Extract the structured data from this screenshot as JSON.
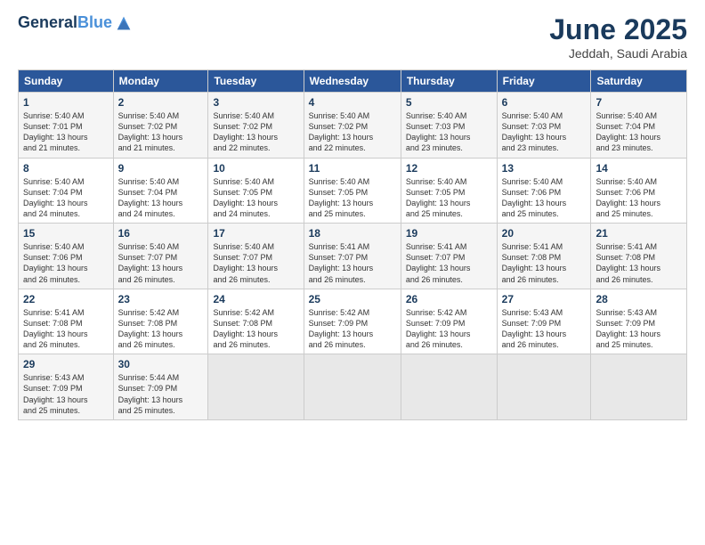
{
  "header": {
    "logo_line1": "General",
    "logo_line2": "Blue",
    "title": "June 2025",
    "subtitle": "Jeddah, Saudi Arabia"
  },
  "days_of_week": [
    "Sunday",
    "Monday",
    "Tuesday",
    "Wednesday",
    "Thursday",
    "Friday",
    "Saturday"
  ],
  "weeks": [
    [
      {
        "day": "1",
        "info": "Sunrise: 5:40 AM\nSunset: 7:01 PM\nDaylight: 13 hours\nand 21 minutes."
      },
      {
        "day": "2",
        "info": "Sunrise: 5:40 AM\nSunset: 7:02 PM\nDaylight: 13 hours\nand 21 minutes."
      },
      {
        "day": "3",
        "info": "Sunrise: 5:40 AM\nSunset: 7:02 PM\nDaylight: 13 hours\nand 22 minutes."
      },
      {
        "day": "4",
        "info": "Sunrise: 5:40 AM\nSunset: 7:02 PM\nDaylight: 13 hours\nand 22 minutes."
      },
      {
        "day": "5",
        "info": "Sunrise: 5:40 AM\nSunset: 7:03 PM\nDaylight: 13 hours\nand 23 minutes."
      },
      {
        "day": "6",
        "info": "Sunrise: 5:40 AM\nSunset: 7:03 PM\nDaylight: 13 hours\nand 23 minutes."
      },
      {
        "day": "7",
        "info": "Sunrise: 5:40 AM\nSunset: 7:04 PM\nDaylight: 13 hours\nand 23 minutes."
      }
    ],
    [
      {
        "day": "8",
        "info": "Sunrise: 5:40 AM\nSunset: 7:04 PM\nDaylight: 13 hours\nand 24 minutes."
      },
      {
        "day": "9",
        "info": "Sunrise: 5:40 AM\nSunset: 7:04 PM\nDaylight: 13 hours\nand 24 minutes."
      },
      {
        "day": "10",
        "info": "Sunrise: 5:40 AM\nSunset: 7:05 PM\nDaylight: 13 hours\nand 24 minutes."
      },
      {
        "day": "11",
        "info": "Sunrise: 5:40 AM\nSunset: 7:05 PM\nDaylight: 13 hours\nand 25 minutes."
      },
      {
        "day": "12",
        "info": "Sunrise: 5:40 AM\nSunset: 7:05 PM\nDaylight: 13 hours\nand 25 minutes."
      },
      {
        "day": "13",
        "info": "Sunrise: 5:40 AM\nSunset: 7:06 PM\nDaylight: 13 hours\nand 25 minutes."
      },
      {
        "day": "14",
        "info": "Sunrise: 5:40 AM\nSunset: 7:06 PM\nDaylight: 13 hours\nand 25 minutes."
      }
    ],
    [
      {
        "day": "15",
        "info": "Sunrise: 5:40 AM\nSunset: 7:06 PM\nDaylight: 13 hours\nand 26 minutes."
      },
      {
        "day": "16",
        "info": "Sunrise: 5:40 AM\nSunset: 7:07 PM\nDaylight: 13 hours\nand 26 minutes."
      },
      {
        "day": "17",
        "info": "Sunrise: 5:40 AM\nSunset: 7:07 PM\nDaylight: 13 hours\nand 26 minutes."
      },
      {
        "day": "18",
        "info": "Sunrise: 5:41 AM\nSunset: 7:07 PM\nDaylight: 13 hours\nand 26 minutes."
      },
      {
        "day": "19",
        "info": "Sunrise: 5:41 AM\nSunset: 7:07 PM\nDaylight: 13 hours\nand 26 minutes."
      },
      {
        "day": "20",
        "info": "Sunrise: 5:41 AM\nSunset: 7:08 PM\nDaylight: 13 hours\nand 26 minutes."
      },
      {
        "day": "21",
        "info": "Sunrise: 5:41 AM\nSunset: 7:08 PM\nDaylight: 13 hours\nand 26 minutes."
      }
    ],
    [
      {
        "day": "22",
        "info": "Sunrise: 5:41 AM\nSunset: 7:08 PM\nDaylight: 13 hours\nand 26 minutes."
      },
      {
        "day": "23",
        "info": "Sunrise: 5:42 AM\nSunset: 7:08 PM\nDaylight: 13 hours\nand 26 minutes."
      },
      {
        "day": "24",
        "info": "Sunrise: 5:42 AM\nSunset: 7:08 PM\nDaylight: 13 hours\nand 26 minutes."
      },
      {
        "day": "25",
        "info": "Sunrise: 5:42 AM\nSunset: 7:09 PM\nDaylight: 13 hours\nand 26 minutes."
      },
      {
        "day": "26",
        "info": "Sunrise: 5:42 AM\nSunset: 7:09 PM\nDaylight: 13 hours\nand 26 minutes."
      },
      {
        "day": "27",
        "info": "Sunrise: 5:43 AM\nSunset: 7:09 PM\nDaylight: 13 hours\nand 26 minutes."
      },
      {
        "day": "28",
        "info": "Sunrise: 5:43 AM\nSunset: 7:09 PM\nDaylight: 13 hours\nand 25 minutes."
      }
    ],
    [
      {
        "day": "29",
        "info": "Sunrise: 5:43 AM\nSunset: 7:09 PM\nDaylight: 13 hours\nand 25 minutes."
      },
      {
        "day": "30",
        "info": "Sunrise: 5:44 AM\nSunset: 7:09 PM\nDaylight: 13 hours\nand 25 minutes."
      },
      {
        "day": "",
        "info": ""
      },
      {
        "day": "",
        "info": ""
      },
      {
        "day": "",
        "info": ""
      },
      {
        "day": "",
        "info": ""
      },
      {
        "day": "",
        "info": ""
      }
    ]
  ]
}
